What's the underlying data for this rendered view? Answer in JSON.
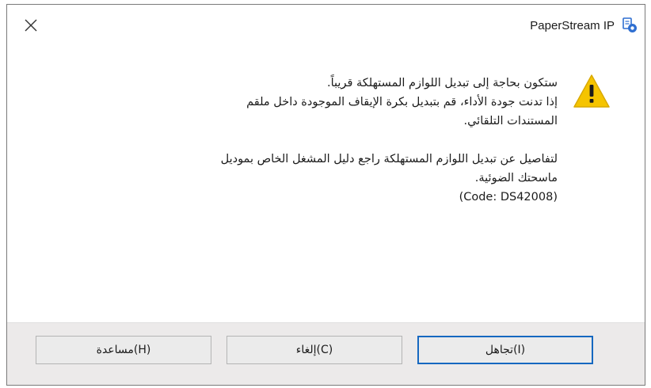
{
  "window": {
    "title": "PaperStream IP",
    "close_icon": "close-icon",
    "app_icon": "paperstream-app-icon"
  },
  "dialog": {
    "icon": "warning-icon",
    "icon_color": "#f5c400",
    "message_para1": "ستكون بحاجة إلى تبديل اللوازم المستهلكة قريباً.\nإذا تدنت جودة الأداء، قم بتبديل بكرة الإيقاف الموجودة داخل ملقم\nالمستندات التلقائي.",
    "message_para2": "لتفاصيل عن تبديل اللوازم المستهلكة راجع دليل المشغل الخاص بموديل\nماسحتك الضوئية.",
    "code": "(Code: DS42008)"
  },
  "buttons": {
    "ignore": "تجاهل(I)",
    "cancel": "إلغاء(C)",
    "help": "مساعدة(H)"
  },
  "colors": {
    "primary_border": "#1668c0",
    "footer_bg": "#eceaea"
  }
}
